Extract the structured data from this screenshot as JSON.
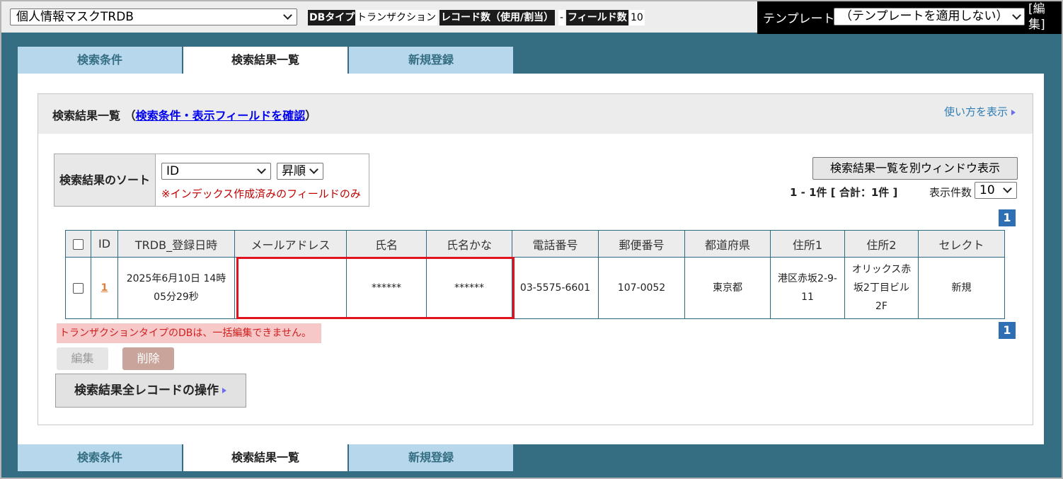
{
  "topbar": {
    "db_select_value": "個人情報マスクTRDB",
    "db_type_label": "DBタイプ",
    "db_type_value": "トランザクション",
    "record_count_label": "レコード数（使用/割当）",
    "record_count_value": "-",
    "field_count_label": "フィールド数",
    "field_count_value": "10",
    "template_label": "テンプレート",
    "template_select_value": "（テンプレートを適用しない）",
    "template_edit": "[編集]"
  },
  "tabs": [
    "検索条件",
    "検索結果一覧",
    "新規登録"
  ],
  "active_tab_index": 1,
  "box": {
    "title_prefix": "検索結果一覧",
    "title_link": "検索条件・表示フィールドを確認",
    "paren_open": "（",
    "paren_close": "）",
    "howto": "使い方を表示"
  },
  "sort": {
    "label": "検索結果のソート",
    "field_value": "ID",
    "order_value": "昇順",
    "note": "※インデックス作成済みのフィールドのみ"
  },
  "open_window_button": "検索結果一覧を別ウィンドウ表示",
  "result_count": "1 - 1件 [ 合計：1件 ]",
  "per_page_label": "表示件数",
  "per_page_value": "10",
  "page_number": "1",
  "table": {
    "headers": [
      "",
      "ID",
      "TRDB_登録日時",
      "メールアドレス",
      "氏名",
      "氏名かな",
      "電話番号",
      "郵便番号",
      "都道府県",
      "住所1",
      "住所2",
      "セレクト"
    ],
    "rows": [
      {
        "id": "1",
        "registered_at": "2025年6月10日 14時05分29秒",
        "email": "",
        "name": "******",
        "name_kana": "******",
        "phone": "03-5575-6601",
        "postal": "107-0052",
        "prefecture": "東京都",
        "address1": "港区赤坂2-9-11",
        "address2": "オリックス赤坂2丁目ビル2F",
        "select": "新規"
      }
    ]
  },
  "warning": "トランザクションタイプのDBは、一括編集できません。",
  "edit_button": "編集",
  "delete_button": "削除",
  "bulk_ops": "検索結果全レコードの操作",
  "colors": {
    "background": "#356e82",
    "tab_inactive": "#b6d7ec",
    "highlight": "#e0141e",
    "pager": "#2e6fb4"
  }
}
